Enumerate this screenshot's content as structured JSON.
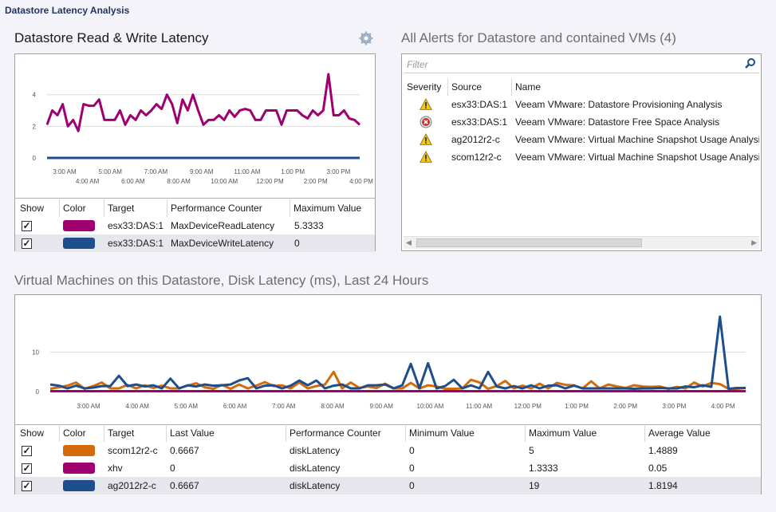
{
  "header": {
    "title": "Datastore Latency Analysis"
  },
  "latency_panel": {
    "title": "Datastore Read & Write Latency",
    "gear_icon": "gear-icon",
    "columns": [
      "Show",
      "Color",
      "Target",
      "Performance Counter",
      "Maximum Value"
    ],
    "rows": [
      {
        "show": true,
        "color": "#a0006f",
        "target": "esx33:DAS:1",
        "counter": "MaxDeviceReadLatency",
        "max": "5.3333"
      },
      {
        "show": true,
        "color": "#1f4e8c",
        "target": "esx33:DAS:1",
        "counter": "MaxDeviceWriteLatency",
        "max": "0"
      }
    ]
  },
  "alerts_panel": {
    "title": "All Alerts for Datastore and contained VMs (4)",
    "filter_placeholder": "Filter",
    "search_icon": "search-icon",
    "columns": [
      "Severity",
      "Source",
      "Name"
    ],
    "rows": [
      {
        "severity": "warning",
        "source": "esx33:DAS:1",
        "name": "Veeam VMware: Datastore Provisioning Analysis"
      },
      {
        "severity": "error",
        "source": "esx33:DAS:1",
        "name": "Veeam VMware: Datastore Free Space Analysis"
      },
      {
        "severity": "warning",
        "source": "ag2012r2-c",
        "name": "Veeam VMware: Virtual Machine Snapshot Usage Analysis"
      },
      {
        "severity": "warning",
        "source": "scom12r2-c",
        "name": "Veeam VMware: Virtual Machine Snapshot Usage Analysis"
      }
    ]
  },
  "vm_panel": {
    "title": "Virtual Machines on this Datastore, Disk Latency (ms), Last 24 Hours",
    "columns": [
      "Show",
      "Color",
      "Target",
      "Last Value",
      "Performance Counter",
      "Minimum Value",
      "Maximum Value",
      "Average Value"
    ],
    "rows": [
      {
        "show": true,
        "color": "#d46a0a",
        "target": "scom12r2-c",
        "last": "0.6667",
        "counter": "diskLatency",
        "min": "0",
        "max": "5",
        "avg": "1.4889"
      },
      {
        "show": true,
        "color": "#a0006f",
        "target": "xhv",
        "last": "0",
        "counter": "diskLatency",
        "min": "0",
        "max": "1.3333",
        "avg": "0.05"
      },
      {
        "show": true,
        "color": "#1f4e8c",
        "target": "ag2012r2-c",
        "last": "0.6667",
        "counter": "diskLatency",
        "min": "0",
        "max": "19",
        "avg": "1.8194"
      }
    ]
  },
  "chart_data": [
    {
      "type": "line",
      "title": "Datastore Read & Write Latency",
      "ylim": [
        0,
        5.5
      ],
      "yticks": [
        "0",
        "2",
        "4"
      ],
      "xticks_upper": [
        "3:00 AM",
        "5:00 AM",
        "7:00 AM",
        "9:00 AM",
        "11:00 AM",
        "1:00 PM",
        "3:00 PM"
      ],
      "xticks_lower": [
        "4:00 AM",
        "6:00 AM",
        "8:00 AM",
        "10:00 AM",
        "12:00 PM",
        "2:00 PM",
        "4:00 PM"
      ],
      "grid": true,
      "series": [
        {
          "color": "#a0006f",
          "values": [
            2.1,
            3.0,
            2.7,
            3.4,
            2.0,
            2.4,
            1.7,
            3.4,
            3.3,
            3.3,
            3.7,
            2.4,
            2.4,
            2.4,
            3.0,
            2.1,
            2.7,
            2.4,
            3.0,
            2.7,
            3.0,
            3.4,
            3.1,
            4.0,
            3.4,
            2.2,
            3.7,
            3.0,
            4.0,
            3.0,
            2.1,
            2.4,
            2.4,
            2.7,
            2.4,
            3.0,
            2.6,
            3.0,
            3.1,
            3.0,
            2.4,
            2.4,
            3.0,
            3.0,
            3.0,
            2.1,
            3.0,
            3.0,
            3.0,
            2.7,
            2.5,
            3.0,
            2.7,
            3.0,
            5.3,
            2.7,
            2.7,
            3.0,
            2.5,
            2.4,
            2.1
          ]
        },
        {
          "color": "#1f4e8c",
          "values": [
            0,
            0
          ]
        }
      ]
    },
    {
      "type": "line",
      "title": "Virtual Machines on this Datastore, Disk Latency (ms), Last 24 Hours",
      "ylim": [
        0,
        20
      ],
      "yticks": [
        "0",
        "10"
      ],
      "xticks": [
        "3:00 AM",
        "4:00 AM",
        "5:00 AM",
        "6:00 AM",
        "7:00 AM",
        "8:00 AM",
        "9:00 AM",
        "10:00 AM",
        "11:00 AM",
        "12:00 PM",
        "1:00 PM",
        "2:00 PM",
        "3:00 PM",
        "4:00 PM"
      ],
      "grid": true,
      "series": [
        {
          "color": "#a0006f",
          "values": [
            0.1,
            0.1
          ]
        },
        {
          "color": "#d46a0a",
          "values": [
            0.7,
            1.1,
            1.5,
            2.3,
            0.7,
            1.4,
            2.3,
            0.8,
            0.8,
            1.7,
            0.8,
            1.6,
            0.9,
            1.5,
            0.8,
            0.8,
            1.5,
            2.1,
            1.1,
            0.7,
            1.7,
            0.7,
            1.8,
            0.8,
            1.5,
            2.4,
            1.4,
            1.6,
            0.8,
            2.3,
            0.8,
            1.4,
            1.8,
            5.0,
            0.8,
            2.3,
            0.9,
            1.3,
            0.9,
            2.0,
            0.8,
            0.8,
            2.2,
            0.8,
            1.6,
            1.3,
            0.7,
            0.7,
            0.8,
            3.0,
            2.3,
            0.7,
            1.4,
            2.7,
            0.8,
            1.5,
            0.8,
            2.0,
            0.8,
            2.2,
            1.7,
            1.6,
            0.8,
            2.6,
            0.8,
            1.8,
            1.3,
            0.9,
            1.6,
            1.3,
            1.2,
            1.3,
            0.7,
            1.2,
            0.8,
            2.3,
            1.3,
            2.2,
            1.9,
            0.7,
            0.7,
            0.9
          ]
        },
        {
          "color": "#1f4e8c",
          "values": [
            1.8,
            1.5,
            0.8,
            1.5,
            0.8,
            1.0,
            1.4,
            1.4,
            4.0,
            1.4,
            1.8,
            1.3,
            1.6,
            0.8,
            3.3,
            0.8,
            1.6,
            1.3,
            1.8,
            1.5,
            1.6,
            1.8,
            2.8,
            3.4,
            0.8,
            1.5,
            1.6,
            0.8,
            1.5,
            2.8,
            1.6,
            2.8,
            0.8,
            1.5,
            1.8,
            0.8,
            0.8,
            1.6,
            1.6,
            1.8,
            0.8,
            1.6,
            7.0,
            0.8,
            7.2,
            0.8,
            1.4,
            3.0,
            0.8,
            1.6,
            0.8,
            5.0,
            1.3,
            0.8,
            1.4,
            0.8,
            1.6,
            0.8,
            1.5,
            1.6,
            0.8,
            1.5,
            0.8,
            0.8,
            0.8,
            0.8,
            0.8,
            0.8,
            0.7,
            0.8,
            0.8,
            0.9,
            0.8,
            0.8,
            1.3,
            1.1,
            1.6,
            1.2,
            19.0,
            0.7,
            0.9,
            0.9
          ]
        }
      ]
    }
  ]
}
